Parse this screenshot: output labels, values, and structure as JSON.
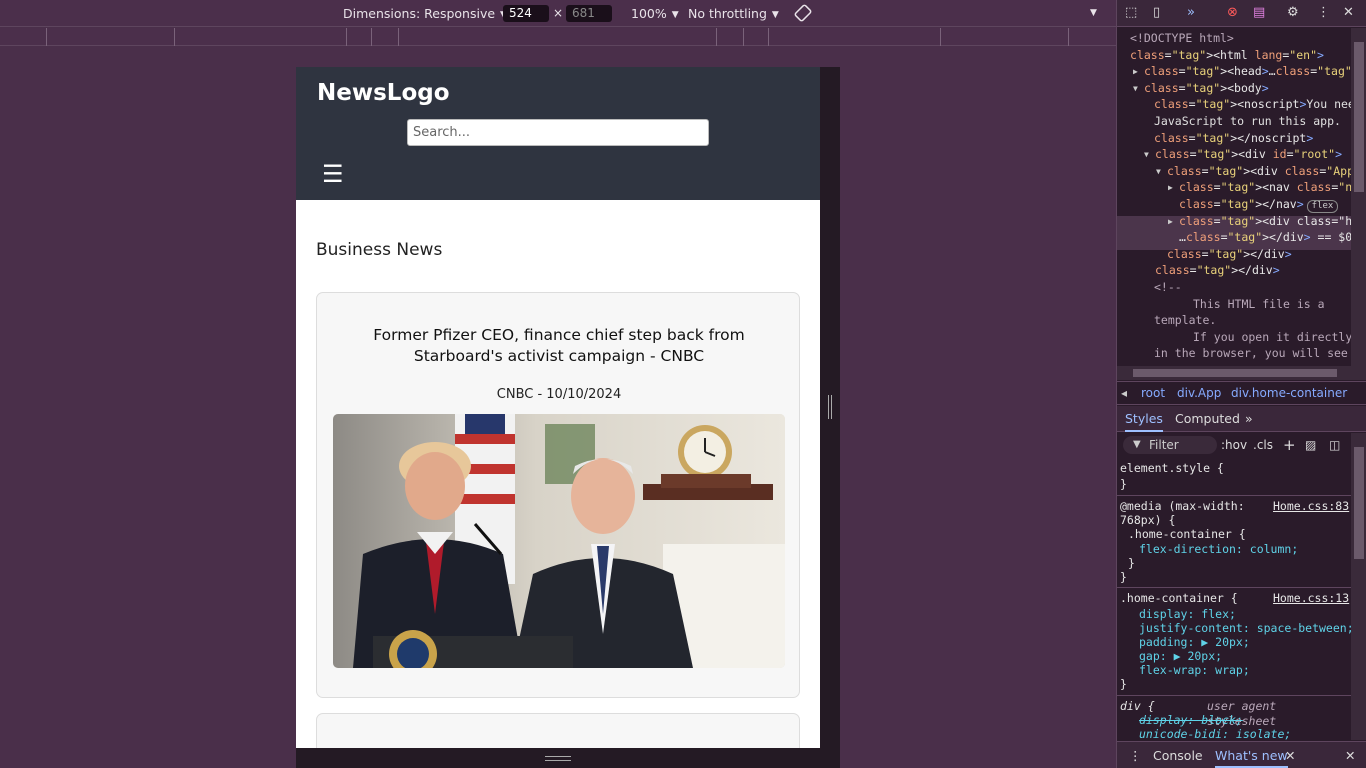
{
  "device_toolbar": {
    "dimensions_label": "Dimensions: Responsive",
    "width": "524",
    "height": "681",
    "times": "×",
    "zoom": "100%",
    "throttling": "No throttling"
  },
  "page": {
    "logo": "NewsLogo",
    "search_placeholder": "Search...",
    "menu_glyph": "☰",
    "section_title": "Business News",
    "articles": [
      {
        "headline": "Former Pfizer CEO, finance chief step back from Starboard's activist campaign - CNBC",
        "meta": "CNBC - 10/10/2024"
      }
    ]
  },
  "devtools": {
    "elements": {
      "lines": [
        {
          "t": "<!DOCTYPE html>",
          "c": "cmt",
          "indent": 13
        },
        {
          "t": "<html lang=\"en\">",
          "indent": 13
        },
        {
          "t": "<head>…</head>",
          "indent": 27
        },
        {
          "t": "<body>",
          "indent": 27
        },
        {
          "t": "<noscript>You need to enable",
          "indent": 37
        },
        {
          "t": "JavaScript to run this app.",
          "indent": 37
        },
        {
          "t": "</noscript>",
          "indent": 37
        },
        {
          "t": "<div id=\"root\">",
          "indent": 38
        },
        {
          "t": "<div class=\"App\">",
          "indent": 50
        },
        {
          "t": "<nav class=\"navbar\">…",
          "indent": 62
        },
        {
          "t": "</nav>",
          "indent": 62
        },
        {
          "t": "<div class=\"home-container",
          "indent": 62
        },
        {
          "t": "…</div> == $0",
          "indent": 62
        },
        {
          "t": "</div>",
          "indent": 50
        },
        {
          "t": "</div>",
          "indent": 38
        },
        {
          "t": "<!--",
          "indent": 37
        },
        {
          "t": "This HTML file is a",
          "indent": 76
        },
        {
          "t": "template.",
          "indent": 37
        },
        {
          "t": "If you open it directly",
          "indent": 76
        },
        {
          "t": "in the browser, you will see a",
          "indent": 37
        }
      ],
      "flex_badge": "flex"
    },
    "breadcrumbs": [
      "root",
      "div.App",
      "div.home-container"
    ],
    "tabs": [
      "Styles",
      "Computed"
    ],
    "filter_label": "Filter",
    "hov": ":hov",
    "cls": ".cls",
    "styles_lines": [
      "element.style {",
      "}",
      "@media (max-width:",
      "768px) {",
      ".home-container {",
      "flex-direction: column;",
      "}",
      "}",
      ".home-container {",
      "display: flex;",
      "justify-content: space-between;",
      "padding: ▶ 20px;",
      "gap: ▶ 20px;",
      "flex-wrap: wrap;",
      "}",
      "div {",
      "display: block;",
      "unicode-bidi: isolate;"
    ],
    "css_link_1": "Home.css:83",
    "css_link_2": "Home.css:13",
    "ua_label": "user agent stylesheet",
    "drawer_tabs": [
      "Console",
      "What's new"
    ]
  }
}
